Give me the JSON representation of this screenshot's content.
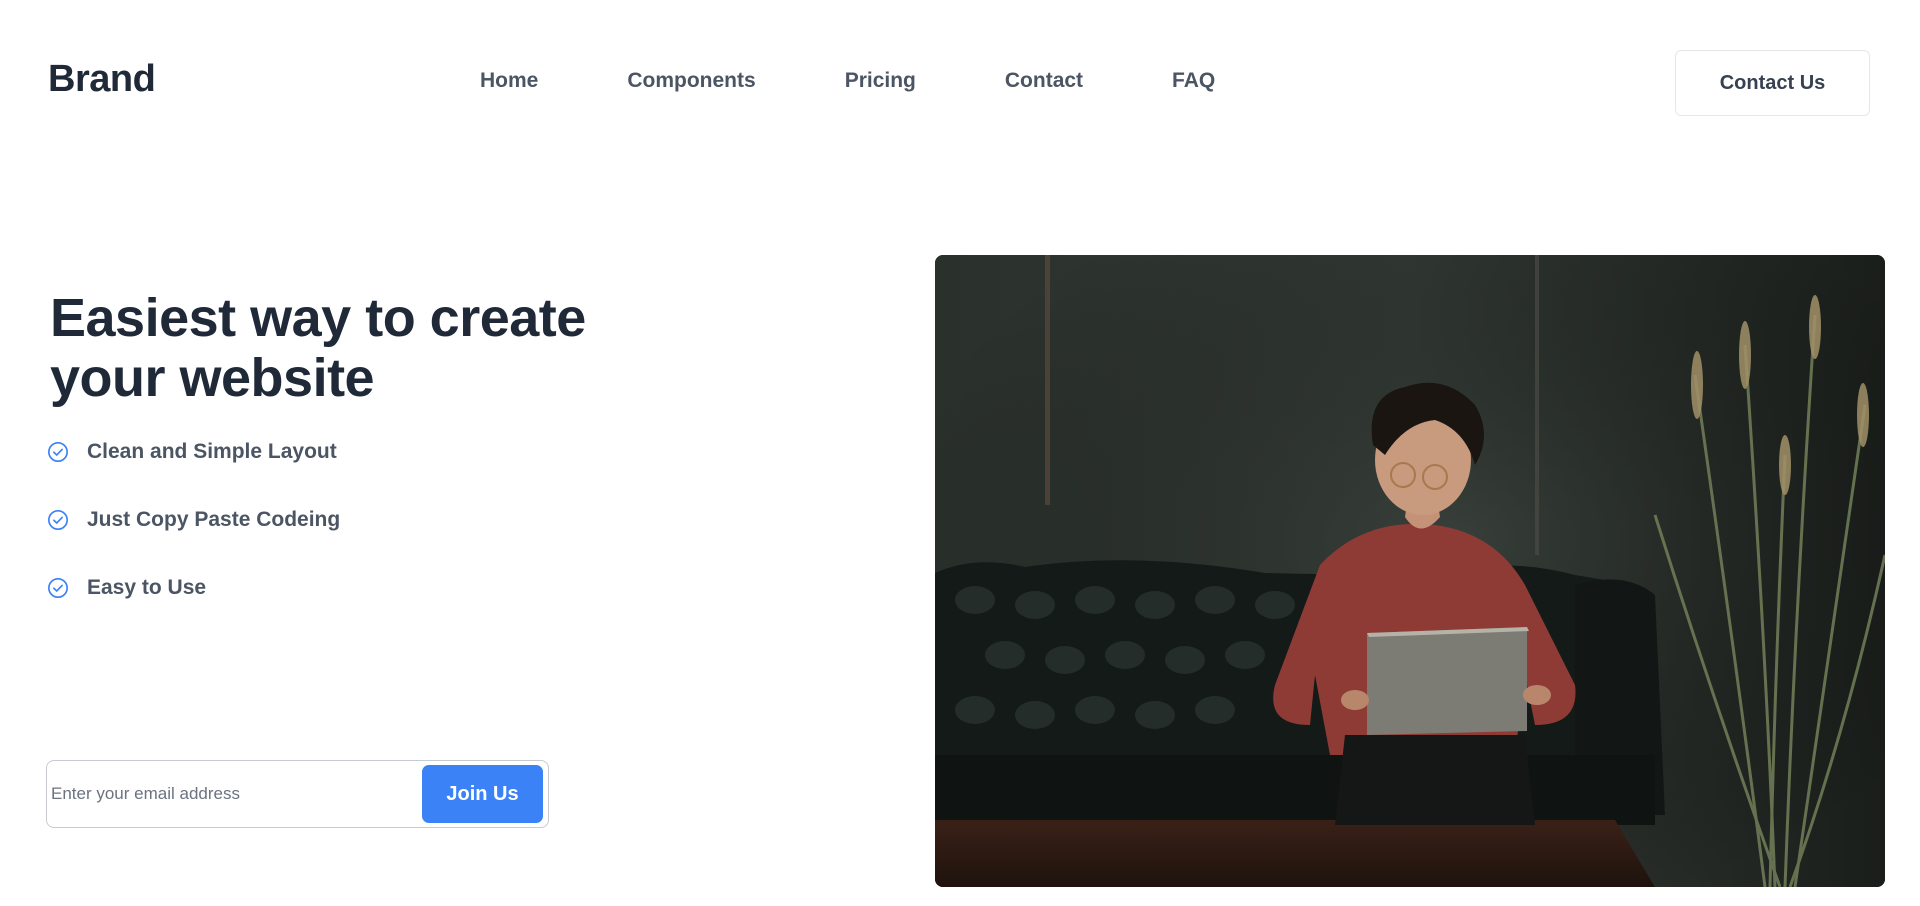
{
  "header": {
    "brand": "Brand",
    "nav": [
      {
        "label": "Home"
      },
      {
        "label": "Components"
      },
      {
        "label": "Pricing"
      },
      {
        "label": "Contact"
      },
      {
        "label": "FAQ"
      }
    ],
    "cta_label": "Contact Us"
  },
  "hero": {
    "headline_line1": "Easiest way to create",
    "headline_line2": "your website",
    "features": [
      {
        "label": "Clean and Simple Layout",
        "icon": "check-circle-icon"
      },
      {
        "label": "Just Copy Paste Codeing",
        "icon": "check-circle-icon"
      },
      {
        "label": "Easy to Use",
        "icon": "check-circle-icon"
      }
    ],
    "email_placeholder": "Enter your email address",
    "join_label": "Join Us"
  },
  "colors": {
    "accent": "#3b82f6",
    "heading": "#1f2937",
    "muted": "#4b5563"
  }
}
